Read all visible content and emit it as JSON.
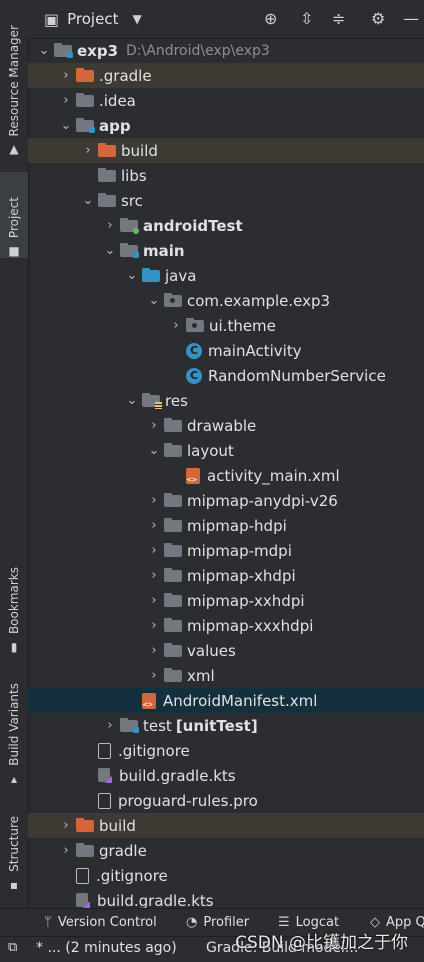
{
  "side_tabs": {
    "resource_manager": "Resource Manager",
    "project": "Project",
    "bookmarks": "Bookmarks",
    "build_variants": "Build Variants",
    "structure": "Structure"
  },
  "header": {
    "title": "Project",
    "view_icon": "project-view-icon",
    "dropdown_icon": "chevron-down-icon",
    "locate_icon": "crosshair-icon",
    "expand_icon": "expand-all-icon",
    "collapse_icon": "collapse-all-icon",
    "settings_icon": "gear-icon",
    "hide_icon": "minimize-icon"
  },
  "tree": {
    "root": {
      "name": "exp3",
      "path": "D:\\Android\\exp\\exp3"
    },
    "gradle_dir": ".gradle",
    "idea_dir": ".idea",
    "app": "app",
    "app_build": "build",
    "libs": "libs",
    "src": "src",
    "android_test": "androidTest",
    "main": "main",
    "java": "java",
    "package": "com.example.exp3",
    "ui_theme": "ui.theme",
    "main_activity": "mainActivity",
    "random_service": "RandomNumberService",
    "class_badge": "C",
    "res": "res",
    "drawable": "drawable",
    "layout": "layout",
    "activity_main": "activity_main.xml",
    "mipmaps": [
      "mipmap-anydpi-v26",
      "mipmap-hdpi",
      "mipmap-mdpi",
      "mipmap-xhdpi",
      "mipmap-xxhdpi",
      "mipmap-xxxhdpi"
    ],
    "values": "values",
    "xml": "xml",
    "manifest": "AndroidManifest.xml",
    "test": "test",
    "test_suffix": "[unitTest]",
    "app_gitignore": ".gitignore",
    "app_build_gradle": "build.gradle.kts",
    "proguard": "proguard-rules.pro",
    "root_build": "build",
    "root_gradle": "gradle",
    "root_gitignore": ".gitignore",
    "root_build_gradle": "build.gradle.kts"
  },
  "toolwindows": {
    "version_control": "Version Control",
    "profiler": "Profiler",
    "logcat": "Logcat",
    "app_quality": "App Q"
  },
  "statusbar": {
    "message": "* ... (2 minutes ago)",
    "gradle": "Gradle: Build model..."
  },
  "watermark": "CSDN @比镬加之于你",
  "colors": {
    "background": "#2b2d30",
    "excluded_row": "#3d3a33",
    "selected_row": "#14303f",
    "excluded_folder": "#d4673a",
    "source_blue": "#3592c4"
  }
}
